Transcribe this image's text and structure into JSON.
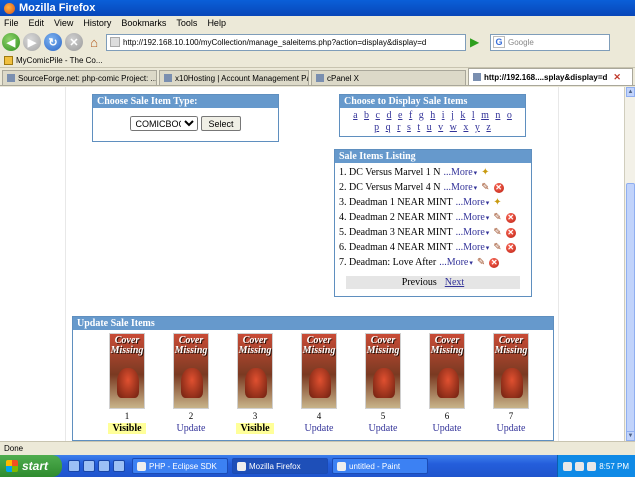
{
  "window": {
    "title": "Mozilla Firefox"
  },
  "menu": [
    "File",
    "Edit",
    "View",
    "History",
    "Bookmarks",
    "Tools",
    "Help"
  ],
  "nav": {
    "url": "http://192.168.10.100/myCollection/manage_saleitems.php?action=display&display=d",
    "search_placeholder": "Google"
  },
  "bookmarks": {
    "item": "MyComicPile - The Co..."
  },
  "tabs": [
    {
      "label": "SourceForge.net: php-comic Project: ...",
      "active": false
    },
    {
      "label": "x10Hosting | Account Management Pa...",
      "active": false
    },
    {
      "label": "cPanel X",
      "active": false
    },
    {
      "label": "http://192.168....splay&display=d",
      "active": true
    }
  ],
  "type_panel": {
    "title": "Choose Sale Item Type:",
    "selected": "COMICBOOK",
    "button": "Select"
  },
  "display_panel": {
    "title": "Choose to Display Sale Items",
    "row1": [
      "a",
      "b",
      "c",
      "d",
      "e",
      "f",
      "g",
      "h",
      "i",
      "j",
      "k",
      "l",
      "m",
      "n",
      "o"
    ],
    "row2": [
      "p",
      "q",
      "r",
      "s",
      "t",
      "u",
      "v",
      "w",
      "x",
      "y",
      "z"
    ]
  },
  "listing": {
    "title": "Sale Items Listing",
    "more_label": "...More",
    "items": [
      {
        "text": "1. DC Versus Marvel 1 N",
        "icons": [
          "star"
        ]
      },
      {
        "text": "2. DC Versus Marvel 4 N",
        "icons": [
          "edit",
          "delete"
        ]
      },
      {
        "text": "3. Deadman 1 NEAR MINT",
        "icons": [
          "star"
        ]
      },
      {
        "text": "4. Deadman 2 NEAR MINT",
        "icons": [
          "edit",
          "delete"
        ]
      },
      {
        "text": "5. Deadman 3 NEAR MINT",
        "icons": [
          "edit",
          "delete"
        ]
      },
      {
        "text": "6. Deadman 4 NEAR MINT",
        "icons": [
          "edit",
          "delete"
        ]
      },
      {
        "text": "7. Deadman: Love After",
        "icons": [
          "edit",
          "delete"
        ]
      }
    ],
    "previous": "Previous",
    "next": "Next"
  },
  "update_panel": {
    "title": "Update Sale Items",
    "cover_text": "Cover Missing",
    "items": [
      {
        "num": "1",
        "action": "Visible",
        "visible": true
      },
      {
        "num": "2",
        "action": "Update",
        "visible": false
      },
      {
        "num": "3",
        "action": "Visible",
        "visible": true
      },
      {
        "num": "4",
        "action": "Update",
        "visible": false
      },
      {
        "num": "5",
        "action": "Update",
        "visible": false
      },
      {
        "num": "6",
        "action": "Update",
        "visible": false
      },
      {
        "num": "7",
        "action": "Update",
        "visible": false
      }
    ]
  },
  "status": {
    "text": "Done"
  },
  "taskbar": {
    "start": "start",
    "tasks": [
      {
        "label": "PHP - Eclipse SDK",
        "active": false
      },
      {
        "label": "Mozilla Firefox",
        "active": true
      },
      {
        "label": "untitled - Paint",
        "active": false
      }
    ],
    "clock": "8:57 PM"
  }
}
